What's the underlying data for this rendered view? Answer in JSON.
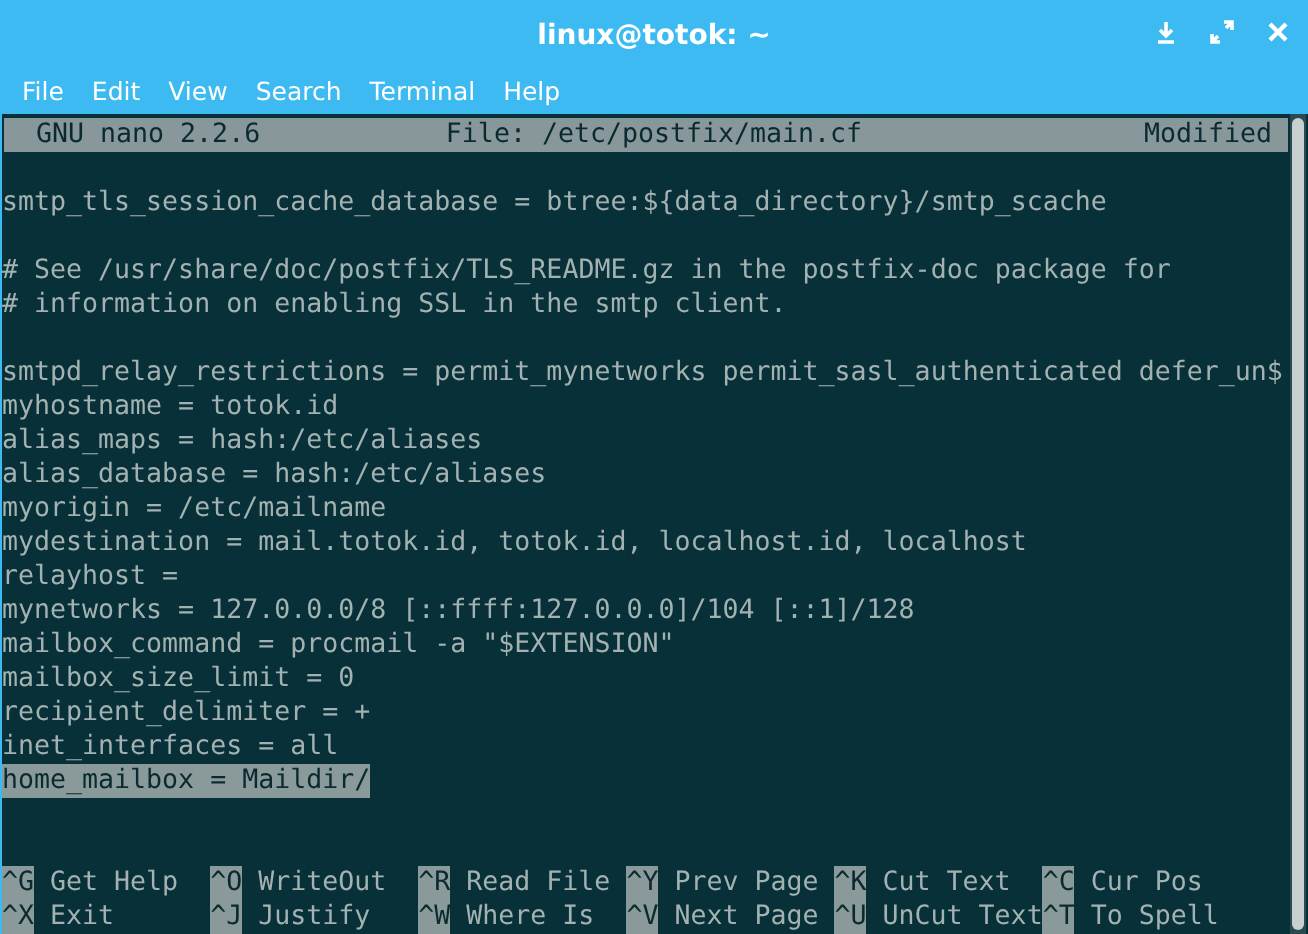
{
  "window": {
    "title": "linux@totok: ~"
  },
  "menu": [
    "File",
    "Edit",
    "View",
    "Search",
    "Terminal",
    "Help"
  ],
  "nano_header": {
    "version": "GNU nano 2.2.6",
    "file": "File: /etc/postfix/main.cf",
    "status": "Modified"
  },
  "lines": [
    {
      "kind": "blank"
    },
    {
      "kind": "text",
      "text": "smtp_tls_session_cache_database = btree:${data_directory}/smtp_scache",
      "selected": false
    },
    {
      "kind": "blank"
    },
    {
      "kind": "text",
      "text": "# See /usr/share/doc/postfix/TLS_README.gz in the postfix-doc package for",
      "selected": false
    },
    {
      "kind": "text",
      "text": "# information on enabling SSL in the smtp client.",
      "selected": false
    },
    {
      "kind": "blank"
    },
    {
      "kind": "text",
      "text": "smtpd_relay_restrictions = permit_mynetworks permit_sasl_authenticated defer_un$",
      "selected": false
    },
    {
      "kind": "text",
      "text": "myhostname = totok.id",
      "selected": false
    },
    {
      "kind": "text",
      "text": "alias_maps = hash:/etc/aliases",
      "selected": false
    },
    {
      "kind": "text",
      "text": "alias_database = hash:/etc/aliases",
      "selected": false
    },
    {
      "kind": "text",
      "text": "myorigin = /etc/mailname",
      "selected": false
    },
    {
      "kind": "text",
      "text": "mydestination = mail.totok.id, totok.id, localhost.id, localhost",
      "selected": false
    },
    {
      "kind": "text",
      "text": "relayhost =",
      "selected": false
    },
    {
      "kind": "text",
      "text": "mynetworks = 127.0.0.0/8 [::ffff:127.0.0.0]/104 [::1]/128",
      "selected": false
    },
    {
      "kind": "text",
      "text": "mailbox_command = procmail -a \"$EXTENSION\"",
      "selected": false
    },
    {
      "kind": "text",
      "text": "mailbox_size_limit = 0",
      "selected": false
    },
    {
      "kind": "text",
      "text": "recipient_delimiter = +",
      "selected": false
    },
    {
      "kind": "text",
      "text": "inet_interfaces = all",
      "selected": false
    },
    {
      "kind": "text",
      "text": "home_mailbox = Maildir/",
      "selected": true
    },
    {
      "kind": "blank"
    },
    {
      "kind": "blank"
    }
  ],
  "shortcuts": [
    [
      {
        "key": "^G",
        "label": "Get Help"
      },
      {
        "key": "^O",
        "label": "WriteOut"
      },
      {
        "key": "^R",
        "label": "Read File"
      },
      {
        "key": "^Y",
        "label": "Prev Page"
      },
      {
        "key": "^K",
        "label": "Cut Text"
      },
      {
        "key": "^C",
        "label": "Cur Pos"
      }
    ],
    [
      {
        "key": "^X",
        "label": "Exit"
      },
      {
        "key": "^J",
        "label": "Justify"
      },
      {
        "key": "^W",
        "label": "Where Is"
      },
      {
        "key": "^V",
        "label": "Next Page"
      },
      {
        "key": "^U",
        "label": "UnCut Text"
      },
      {
        "key": "^T",
        "label": "To Spell"
      }
    ]
  ]
}
